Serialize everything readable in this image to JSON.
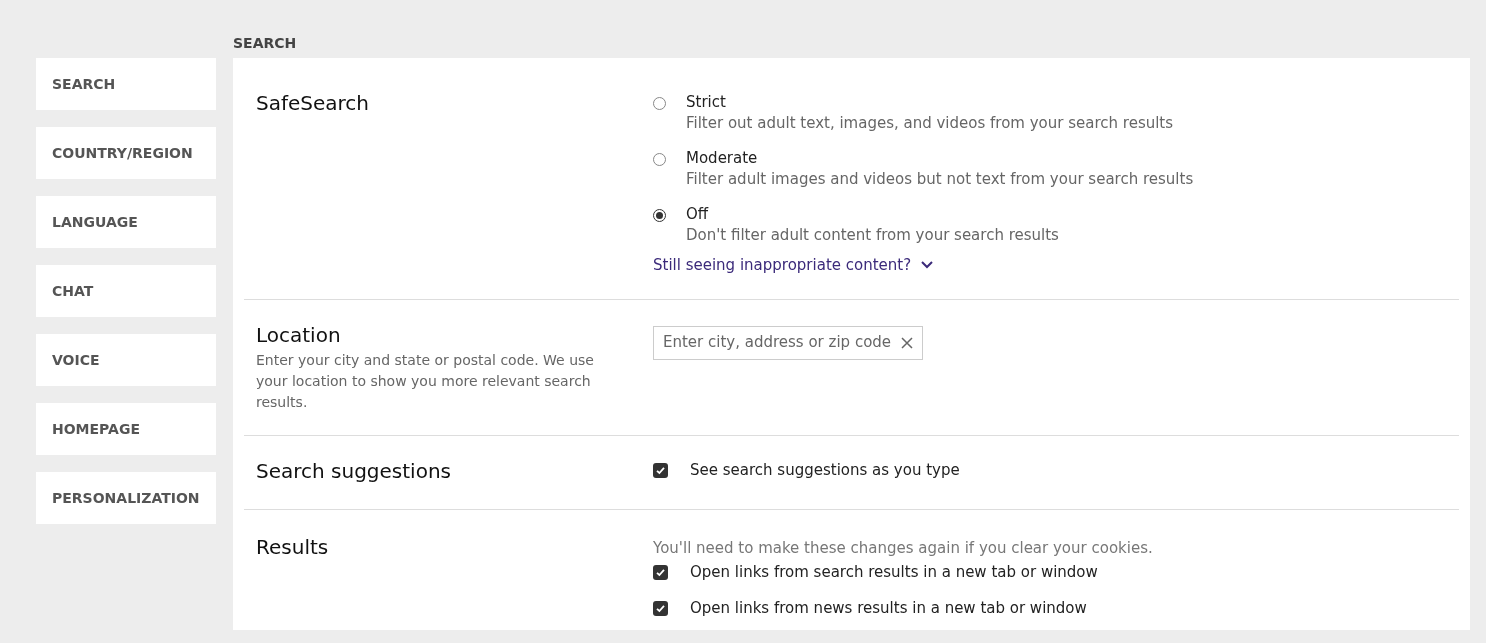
{
  "sidebar": {
    "items": [
      {
        "label": "SEARCH"
      },
      {
        "label": "COUNTRY/REGION"
      },
      {
        "label": "LANGUAGE"
      },
      {
        "label": "CHAT"
      },
      {
        "label": "VOICE"
      },
      {
        "label": "HOMEPAGE"
      },
      {
        "label": "PERSONALIZATION"
      }
    ]
  },
  "heading": "SEARCH",
  "sections": [
    {
      "kind": "radio",
      "title": "SafeSearch",
      "options": [
        {
          "label": "Strict",
          "description": "Filter out adult text, images, and videos from your search results",
          "selected": false
        },
        {
          "label": "Moderate",
          "description": "Filter adult images and videos but not text from your search results",
          "selected": false
        },
        {
          "label": "Off",
          "description": "Don't filter adult content from your search results",
          "selected": true
        }
      ],
      "link": "Still seeing inappropriate content?"
    },
    {
      "kind": "field",
      "title": "Location",
      "description": "Enter your city and state or postal code. We use your location to show you more relevant search results.",
      "placeholder": "Enter city, address or zip code"
    },
    {
      "kind": "checks",
      "title": "Search suggestions",
      "options": [
        {
          "label": "See search suggestions as you type",
          "checked": true
        }
      ]
    },
    {
      "kind": "checks",
      "title": "Results",
      "note": "You'll need to make these changes again if you clear your cookies.",
      "options": [
        {
          "label": "Open links from search results in a new tab or window",
          "checked": true
        },
        {
          "label": "Open links from news results in a new tab or window",
          "checked": true
        }
      ]
    }
  ]
}
